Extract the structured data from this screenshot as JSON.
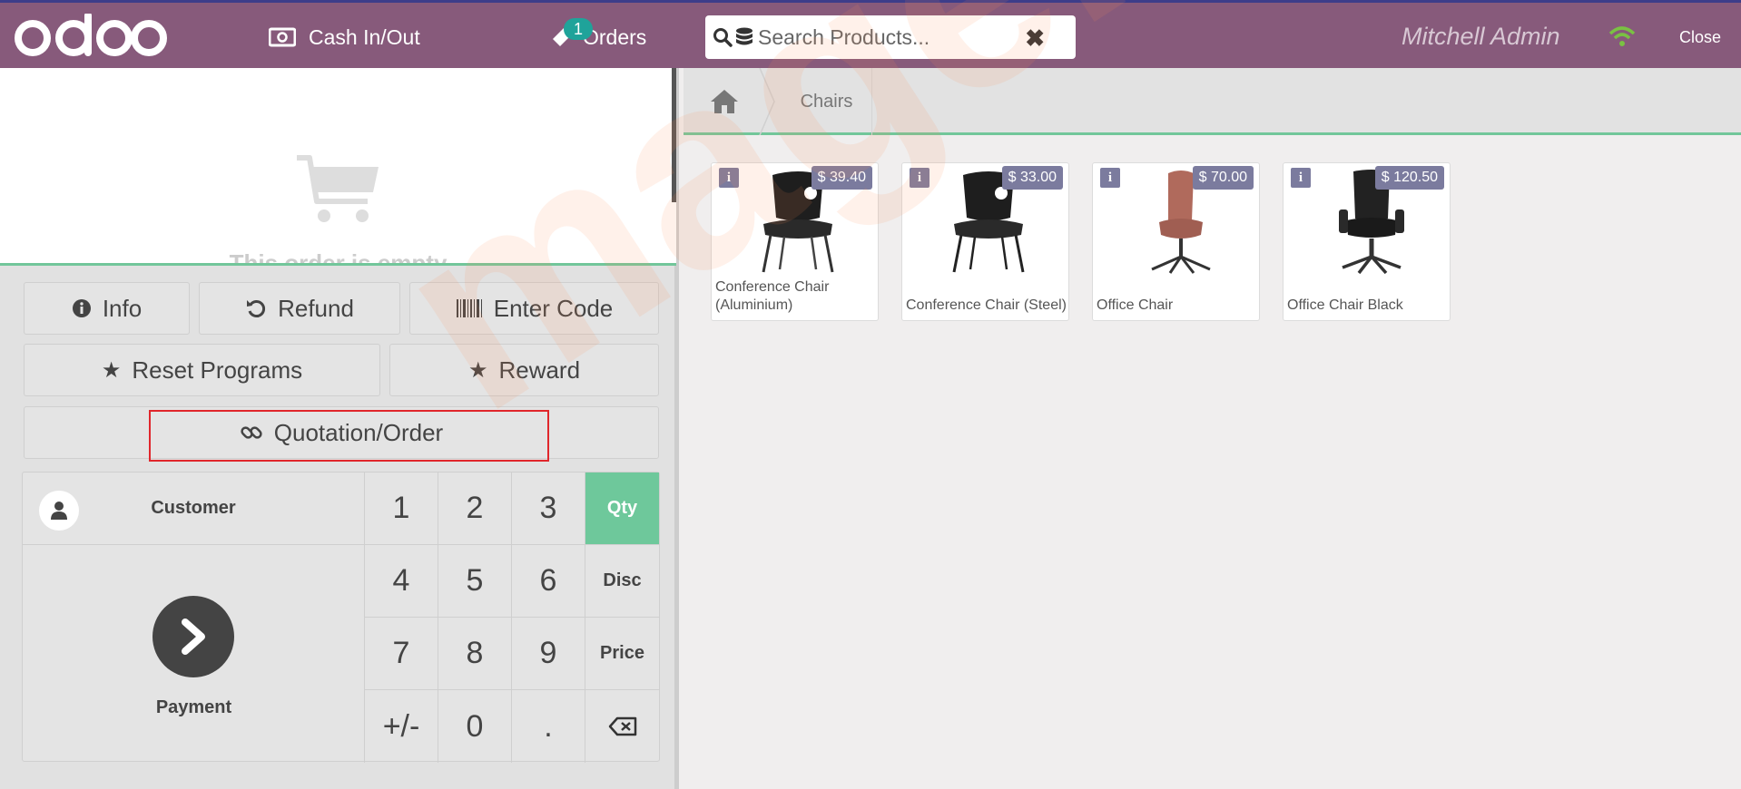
{
  "header": {
    "cash_label": "Cash In/Out",
    "orders_label": "Orders",
    "orders_count": "1",
    "search_placeholder": "Search Products...",
    "user_name": "Mitchell Admin",
    "close_label": "Close"
  },
  "order": {
    "empty_text": "This order is empty"
  },
  "controls": {
    "info": "Info",
    "refund": "Refund",
    "enter_code": "Enter Code",
    "reset_programs": "Reset Programs",
    "reward": "Reward",
    "quotation": "Quotation/Order"
  },
  "numpad": {
    "customer": "Customer",
    "payment": "Payment",
    "keys": [
      "1",
      "2",
      "3",
      "4",
      "5",
      "6",
      "7",
      "8",
      "9",
      "+/-",
      "0",
      "."
    ],
    "modes": [
      "Qty",
      "Disc",
      "Price"
    ]
  },
  "breadcrumb": {
    "category": "Chairs"
  },
  "products": [
    {
      "name": "Conference Chair (Aluminium)",
      "price": "$ 39.40"
    },
    {
      "name": "Conference Chair (Steel)",
      "price": "$ 33.00"
    },
    {
      "name": "Office Chair",
      "price": "$ 70.00"
    },
    {
      "name": "Office Chair Black",
      "price": "$ 120.50"
    }
  ],
  "watermark": "magenest",
  "colors": {
    "topbar": "#875a7b",
    "accent_green": "#6ec89b",
    "price_badge": "#7b7b9e",
    "highlight": "#e0262b"
  }
}
